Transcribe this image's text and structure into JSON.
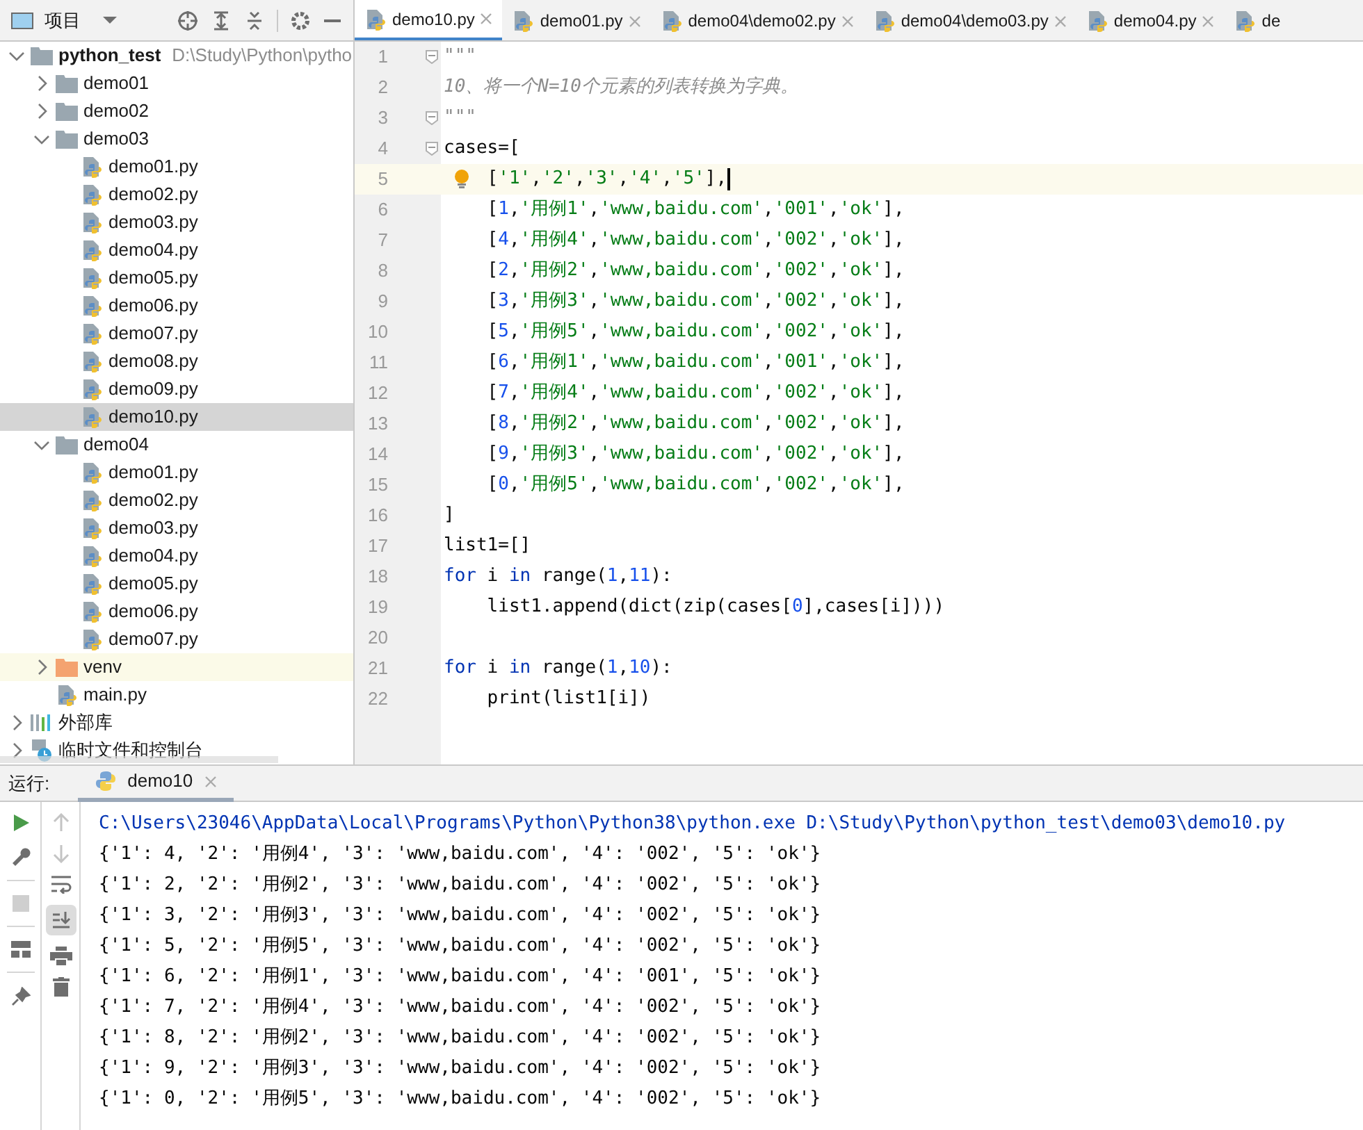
{
  "project_panel": {
    "title": "项目"
  },
  "tree": [
    {
      "label": "python_test",
      "path": "D:\\Study\\Python\\pytho",
      "kind": "folder",
      "expanded": true,
      "selected": false,
      "children": [
        {
          "label": "demo01",
          "kind": "folder",
          "expanded": false,
          "selected": false
        },
        {
          "label": "demo02",
          "kind": "folder",
          "expanded": false,
          "selected": false
        },
        {
          "label": "demo03",
          "kind": "folder",
          "expanded": true,
          "selected": false,
          "children": [
            {
              "label": "demo01.py",
              "kind": "file",
              "selected": false
            },
            {
              "label": "demo02.py",
              "kind": "file",
              "selected": false
            },
            {
              "label": "demo03.py",
              "kind": "file",
              "selected": false
            },
            {
              "label": "demo04.py",
              "kind": "file",
              "selected": false
            },
            {
              "label": "demo05.py",
              "kind": "file",
              "selected": false
            },
            {
              "label": "demo06.py",
              "kind": "file",
              "selected": false
            },
            {
              "label": "demo07.py",
              "kind": "file",
              "selected": false
            },
            {
              "label": "demo08.py",
              "kind": "file",
              "selected": false
            },
            {
              "label": "demo09.py",
              "kind": "file",
              "selected": false
            },
            {
              "label": "demo10.py",
              "kind": "file",
              "selected": true
            }
          ]
        },
        {
          "label": "demo04",
          "kind": "folder",
          "expanded": true,
          "selected": false,
          "children": [
            {
              "label": "demo01.py",
              "kind": "file",
              "selected": false
            },
            {
              "label": "demo02.py",
              "kind": "file",
              "selected": false
            },
            {
              "label": "demo03.py",
              "kind": "file",
              "selected": false
            },
            {
              "label": "demo04.py",
              "kind": "file",
              "selected": false
            },
            {
              "label": "demo05.py",
              "kind": "file",
              "selected": false
            },
            {
              "label": "demo06.py",
              "kind": "file",
              "selected": false
            },
            {
              "label": "demo07.py",
              "kind": "file",
              "selected": false
            }
          ]
        },
        {
          "label": "venv",
          "kind": "excluded-folder",
          "expanded": false,
          "selected": false
        },
        {
          "label": "main.py",
          "kind": "file",
          "selected": false
        }
      ]
    },
    {
      "label": "外部库",
      "kind": "library",
      "expanded": false,
      "selected": false
    },
    {
      "label": "临时文件和控制台",
      "kind": "scratch",
      "expanded": false,
      "selected": false
    }
  ],
  "tabs": [
    {
      "label": "demo10.py",
      "selected": true,
      "closable": true
    },
    {
      "label": "demo01.py",
      "selected": false,
      "closable": true
    },
    {
      "label": "demo04\\demo02.py",
      "selected": false,
      "closable": true
    },
    {
      "label": "demo04\\demo03.py",
      "selected": false,
      "closable": true
    },
    {
      "label": "demo04.py",
      "selected": false,
      "closable": true
    },
    {
      "label": "de",
      "selected": false,
      "closable": false
    }
  ],
  "code_lines": [
    {
      "number": "1",
      "fold": true,
      "current": false,
      "tokens": [
        {
          "kind": "doc",
          "text": "\"\"\""
        }
      ]
    },
    {
      "number": "2",
      "fold": false,
      "current": false,
      "tokens": [
        {
          "kind": "doc",
          "text": "10、将一个N=10个元素的列表转换为字典。"
        }
      ]
    },
    {
      "number": "3",
      "fold": true,
      "current": false,
      "tokens": [
        {
          "kind": "doc",
          "text": "\"\"\""
        }
      ]
    },
    {
      "number": "4",
      "fold": true,
      "current": false,
      "tokens": [
        {
          "kind": "plain",
          "text": "cases=["
        }
      ]
    },
    {
      "number": "5",
      "fold": false,
      "current": true,
      "tokens": [
        {
          "kind": "plain",
          "text": "    ["
        },
        {
          "kind": "string",
          "text": "'1'"
        },
        {
          "kind": "plain",
          "text": ","
        },
        {
          "kind": "string",
          "text": "'2'"
        },
        {
          "kind": "plain",
          "text": ","
        },
        {
          "kind": "string",
          "text": "'3'"
        },
        {
          "kind": "plain",
          "text": ","
        },
        {
          "kind": "string",
          "text": "'4'"
        },
        {
          "kind": "plain",
          "text": ","
        },
        {
          "kind": "string",
          "text": "'5'"
        },
        {
          "kind": "plain",
          "text": "],"
        }
      ]
    },
    {
      "number": "6",
      "fold": false,
      "current": false,
      "tokens": [
        {
          "kind": "plain",
          "text": "    ["
        },
        {
          "kind": "number",
          "text": "1"
        },
        {
          "kind": "plain",
          "text": ","
        },
        {
          "kind": "string",
          "text": "'用例1'"
        },
        {
          "kind": "plain",
          "text": ","
        },
        {
          "kind": "string",
          "text": "'www,baidu.com'"
        },
        {
          "kind": "plain",
          "text": ","
        },
        {
          "kind": "string",
          "text": "'001'"
        },
        {
          "kind": "plain",
          "text": ","
        },
        {
          "kind": "string",
          "text": "'ok'"
        },
        {
          "kind": "plain",
          "text": "],"
        }
      ]
    },
    {
      "number": "7",
      "fold": false,
      "current": false,
      "tokens": [
        {
          "kind": "plain",
          "text": "    ["
        },
        {
          "kind": "number",
          "text": "4"
        },
        {
          "kind": "plain",
          "text": ","
        },
        {
          "kind": "string",
          "text": "'用例4'"
        },
        {
          "kind": "plain",
          "text": ","
        },
        {
          "kind": "string",
          "text": "'www,baidu.com'"
        },
        {
          "kind": "plain",
          "text": ","
        },
        {
          "kind": "string",
          "text": "'002'"
        },
        {
          "kind": "plain",
          "text": ","
        },
        {
          "kind": "string",
          "text": "'ok'"
        },
        {
          "kind": "plain",
          "text": "],"
        }
      ]
    },
    {
      "number": "8",
      "fold": false,
      "current": false,
      "tokens": [
        {
          "kind": "plain",
          "text": "    ["
        },
        {
          "kind": "number",
          "text": "2"
        },
        {
          "kind": "plain",
          "text": ","
        },
        {
          "kind": "string",
          "text": "'用例2'"
        },
        {
          "kind": "plain",
          "text": ","
        },
        {
          "kind": "string",
          "text": "'www,baidu.com'"
        },
        {
          "kind": "plain",
          "text": ","
        },
        {
          "kind": "string",
          "text": "'002'"
        },
        {
          "kind": "plain",
          "text": ","
        },
        {
          "kind": "string",
          "text": "'ok'"
        },
        {
          "kind": "plain",
          "text": "],"
        }
      ]
    },
    {
      "number": "9",
      "fold": false,
      "current": false,
      "tokens": [
        {
          "kind": "plain",
          "text": "    ["
        },
        {
          "kind": "number",
          "text": "3"
        },
        {
          "kind": "plain",
          "text": ","
        },
        {
          "kind": "string",
          "text": "'用例3'"
        },
        {
          "kind": "plain",
          "text": ","
        },
        {
          "kind": "string",
          "text": "'www,baidu.com'"
        },
        {
          "kind": "plain",
          "text": ","
        },
        {
          "kind": "string",
          "text": "'002'"
        },
        {
          "kind": "plain",
          "text": ","
        },
        {
          "kind": "string",
          "text": "'ok'"
        },
        {
          "kind": "plain",
          "text": "],"
        }
      ]
    },
    {
      "number": "10",
      "fold": false,
      "current": false,
      "tokens": [
        {
          "kind": "plain",
          "text": "    ["
        },
        {
          "kind": "number",
          "text": "5"
        },
        {
          "kind": "plain",
          "text": ","
        },
        {
          "kind": "string",
          "text": "'用例5'"
        },
        {
          "kind": "plain",
          "text": ","
        },
        {
          "kind": "string",
          "text": "'www,baidu.com'"
        },
        {
          "kind": "plain",
          "text": ","
        },
        {
          "kind": "string",
          "text": "'002'"
        },
        {
          "kind": "plain",
          "text": ","
        },
        {
          "kind": "string",
          "text": "'ok'"
        },
        {
          "kind": "plain",
          "text": "],"
        }
      ]
    },
    {
      "number": "11",
      "fold": false,
      "current": false,
      "tokens": [
        {
          "kind": "plain",
          "text": "    ["
        },
        {
          "kind": "number",
          "text": "6"
        },
        {
          "kind": "plain",
          "text": ","
        },
        {
          "kind": "string",
          "text": "'用例1'"
        },
        {
          "kind": "plain",
          "text": ","
        },
        {
          "kind": "string",
          "text": "'www,baidu.com'"
        },
        {
          "kind": "plain",
          "text": ","
        },
        {
          "kind": "string",
          "text": "'001'"
        },
        {
          "kind": "plain",
          "text": ","
        },
        {
          "kind": "string",
          "text": "'ok'"
        },
        {
          "kind": "plain",
          "text": "],"
        }
      ]
    },
    {
      "number": "12",
      "fold": false,
      "current": false,
      "tokens": [
        {
          "kind": "plain",
          "text": "    ["
        },
        {
          "kind": "number",
          "text": "7"
        },
        {
          "kind": "plain",
          "text": ","
        },
        {
          "kind": "string",
          "text": "'用例4'"
        },
        {
          "kind": "plain",
          "text": ","
        },
        {
          "kind": "string",
          "text": "'www,baidu.com'"
        },
        {
          "kind": "plain",
          "text": ","
        },
        {
          "kind": "string",
          "text": "'002'"
        },
        {
          "kind": "plain",
          "text": ","
        },
        {
          "kind": "string",
          "text": "'ok'"
        },
        {
          "kind": "plain",
          "text": "],"
        }
      ]
    },
    {
      "number": "13",
      "fold": false,
      "current": false,
      "tokens": [
        {
          "kind": "plain",
          "text": "    ["
        },
        {
          "kind": "number",
          "text": "8"
        },
        {
          "kind": "plain",
          "text": ","
        },
        {
          "kind": "string",
          "text": "'用例2'"
        },
        {
          "kind": "plain",
          "text": ","
        },
        {
          "kind": "string",
          "text": "'www,baidu.com'"
        },
        {
          "kind": "plain",
          "text": ","
        },
        {
          "kind": "string",
          "text": "'002'"
        },
        {
          "kind": "plain",
          "text": ","
        },
        {
          "kind": "string",
          "text": "'ok'"
        },
        {
          "kind": "plain",
          "text": "],"
        }
      ]
    },
    {
      "number": "14",
      "fold": false,
      "current": false,
      "tokens": [
        {
          "kind": "plain",
          "text": "    ["
        },
        {
          "kind": "number",
          "text": "9"
        },
        {
          "kind": "plain",
          "text": ","
        },
        {
          "kind": "string",
          "text": "'用例3'"
        },
        {
          "kind": "plain",
          "text": ","
        },
        {
          "kind": "string",
          "text": "'www,baidu.com'"
        },
        {
          "kind": "plain",
          "text": ","
        },
        {
          "kind": "string",
          "text": "'002'"
        },
        {
          "kind": "plain",
          "text": ","
        },
        {
          "kind": "string",
          "text": "'ok'"
        },
        {
          "kind": "plain",
          "text": "],"
        }
      ]
    },
    {
      "number": "15",
      "fold": false,
      "current": false,
      "tokens": [
        {
          "kind": "plain",
          "text": "    ["
        },
        {
          "kind": "number",
          "text": "0"
        },
        {
          "kind": "plain",
          "text": ","
        },
        {
          "kind": "string",
          "text": "'用例5'"
        },
        {
          "kind": "plain",
          "text": ","
        },
        {
          "kind": "string",
          "text": "'www,baidu.com'"
        },
        {
          "kind": "plain",
          "text": ","
        },
        {
          "kind": "string",
          "text": "'002'"
        },
        {
          "kind": "plain",
          "text": ","
        },
        {
          "kind": "string",
          "text": "'ok'"
        },
        {
          "kind": "plain",
          "text": "],"
        }
      ]
    },
    {
      "number": "16",
      "fold": false,
      "current": false,
      "tokens": [
        {
          "kind": "plain",
          "text": "]"
        }
      ]
    },
    {
      "number": "17",
      "fold": false,
      "current": false,
      "tokens": [
        {
          "kind": "plain",
          "text": "list1=[]"
        }
      ]
    },
    {
      "number": "18",
      "fold": false,
      "current": false,
      "tokens": [
        {
          "kind": "keyword",
          "text": "for"
        },
        {
          "kind": "plain",
          "text": " i "
        },
        {
          "kind": "keyword",
          "text": "in"
        },
        {
          "kind": "plain",
          "text": " range("
        },
        {
          "kind": "number",
          "text": "1"
        },
        {
          "kind": "plain",
          "text": ","
        },
        {
          "kind": "number",
          "text": "11"
        },
        {
          "kind": "plain",
          "text": "):"
        }
      ]
    },
    {
      "number": "19",
      "fold": false,
      "current": false,
      "tokens": [
        {
          "kind": "plain",
          "text": "    list1.append(dict(zip(cases["
        },
        {
          "kind": "number",
          "text": "0"
        },
        {
          "kind": "plain",
          "text": "],cases[i])))"
        }
      ]
    },
    {
      "number": "20",
      "fold": false,
      "current": false
    },
    {
      "number": "21",
      "fold": false,
      "current": false,
      "tokens": [
        {
          "kind": "keyword",
          "text": "for"
        },
        {
          "kind": "plain",
          "text": " i "
        },
        {
          "kind": "keyword",
          "text": "in"
        },
        {
          "kind": "plain",
          "text": " range("
        },
        {
          "kind": "number",
          "text": "1"
        },
        {
          "kind": "plain",
          "text": ","
        },
        {
          "kind": "number",
          "text": "10"
        },
        {
          "kind": "plain",
          "text": "):"
        }
      ]
    },
    {
      "number": "22",
      "fold": false,
      "current": false,
      "tokens": [
        {
          "kind": "plain",
          "text": "    print(list1[i])"
        }
      ]
    }
  ],
  "run_panel": {
    "label": "运行:",
    "tab": "demo10",
    "console": [
      {
        "kind": "command",
        "text": "C:\\Users\\23046\\AppData\\Local\\Programs\\Python\\Python38\\python.exe D:\\Study\\Python\\python_test\\demo03\\demo10.py"
      },
      {
        "kind": "output",
        "text": "{'1': 4, '2': '用例4', '3': 'www,baidu.com', '4': '002', '5': 'ok'}"
      },
      {
        "kind": "output",
        "text": "{'1': 2, '2': '用例2', '3': 'www,baidu.com', '4': '002', '5': 'ok'}"
      },
      {
        "kind": "output",
        "text": "{'1': 3, '2': '用例3', '3': 'www,baidu.com', '4': '002', '5': 'ok'}"
      },
      {
        "kind": "output",
        "text": "{'1': 5, '2': '用例5', '3': 'www,baidu.com', '4': '002', '5': 'ok'}"
      },
      {
        "kind": "output",
        "text": "{'1': 6, '2': '用例1', '3': 'www,baidu.com', '4': '001', '5': 'ok'}"
      },
      {
        "kind": "output",
        "text": "{'1': 7, '2': '用例4', '3': 'www,baidu.com', '4': '002', '5': 'ok'}"
      },
      {
        "kind": "output",
        "text": "{'1': 8, '2': '用例2', '3': 'www,baidu.com', '4': '002', '5': 'ok'}"
      },
      {
        "kind": "output",
        "text": "{'1': 9, '2': '用例3', '3': 'www,baidu.com', '4': '002', '5': 'ok'}"
      },
      {
        "kind": "output",
        "text": "{'1': 0, '2': '用例5', '3': 'www,baidu.com', '4': '002', '5': 'ok'}"
      }
    ]
  }
}
